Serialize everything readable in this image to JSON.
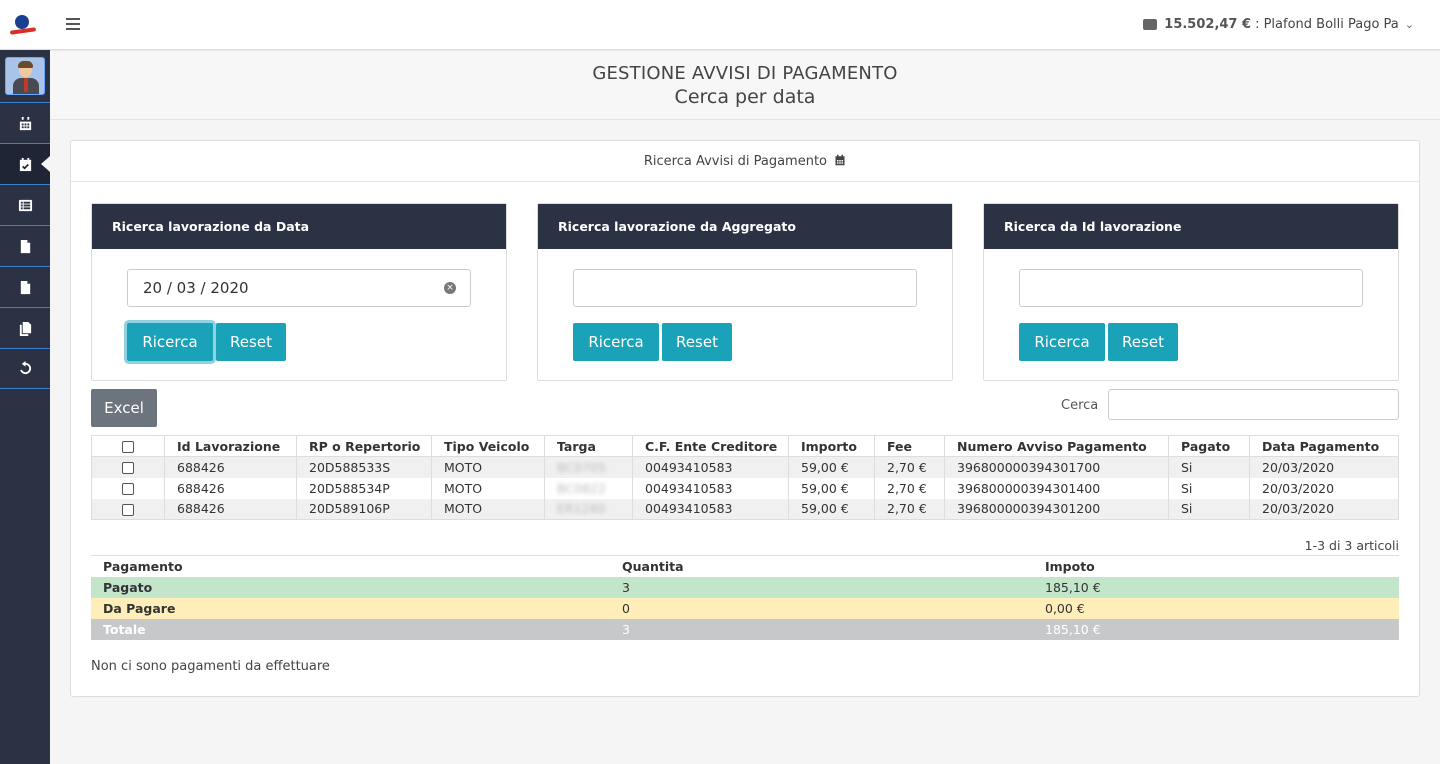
{
  "header": {
    "plafond_amount": "15.502,47 €",
    "plafond_label": ": Plafond Bolli Pago Pa"
  },
  "sidebar": {
    "items": [
      {
        "icon": "calendar-icon"
      },
      {
        "icon": "calendar-check-icon",
        "active": true
      },
      {
        "icon": "list-icon"
      },
      {
        "icon": "file-icon"
      },
      {
        "icon": "file-icon"
      },
      {
        "icon": "copy-icon"
      },
      {
        "icon": "undo-icon"
      }
    ]
  },
  "page": {
    "title": "GESTIONE AVVISI DI PAGAMENTO",
    "subtitle": "Cerca per data"
  },
  "panel": {
    "title": "Ricerca Avvisi di Pagamento"
  },
  "cards": [
    {
      "title": "Ricerca lavorazione da Data",
      "value": "20 / 03 / 2020",
      "btn_search": "Ricerca",
      "btn_reset": "Reset"
    },
    {
      "title": "Ricerca lavorazione da Aggregato",
      "value": "",
      "btn_search": "Ricerca",
      "btn_reset": "Reset"
    },
    {
      "title": "Ricerca da Id lavorazione",
      "value": "",
      "btn_search": "Ricerca",
      "btn_reset": "Reset"
    }
  ],
  "toolbar": {
    "excel": "Excel",
    "search_label": "Cerca"
  },
  "table": {
    "columns": [
      "Id Lavorazione",
      "RP o Repertorio",
      "Tipo Veicolo",
      "Targa",
      "C.F. Ente Creditore",
      "Importo",
      "Fee",
      "Numero Avviso Pagamento",
      "Pagato",
      "Data Pagamento"
    ],
    "rows": [
      {
        "id": "688426",
        "rp": "20D588533S",
        "tipo": "MOTO",
        "targa": "BC0705",
        "cf": "00493410583",
        "importo": "59,00 €",
        "fee": "2,70 €",
        "avviso": "396800000394301700",
        "pagato": "Si",
        "data": "20/03/2020"
      },
      {
        "id": "688426",
        "rp": "20D588534P",
        "tipo": "MOTO",
        "targa": "BC0822",
        "cf": "00493410583",
        "importo": "59,00 €",
        "fee": "2,70 €",
        "avviso": "396800000394301400",
        "pagato": "Si",
        "data": "20/03/2020"
      },
      {
        "id": "688426",
        "rp": "20D589106P",
        "tipo": "MOTO",
        "targa": "ER1280",
        "cf": "00493410583",
        "importo": "59,00 €",
        "fee": "2,70 €",
        "avviso": "396800000394301200",
        "pagato": "Si",
        "data": "20/03/2020"
      }
    ],
    "count_text": "1-3 di 3 articoli"
  },
  "summary": {
    "headers": [
      "Pagamento",
      "Quantita",
      "Impoto"
    ],
    "rows": [
      {
        "label": "Pagato",
        "qty": "3",
        "amount": "185,10 €"
      },
      {
        "label": "Da Pagare",
        "qty": "0",
        "amount": "0,00 €"
      },
      {
        "label": "Totale",
        "qty": "3",
        "amount": "185,10 €"
      }
    ]
  },
  "note": "Non ci sono pagamenti da effettuare",
  "colors": {
    "sidebar": "#2b3244",
    "accent": "#1aa2b8",
    "excel": "#6c757d",
    "pagato": "#c3e6cb",
    "da_pagare": "#ffeeba",
    "totale": "#c6c8ca"
  }
}
